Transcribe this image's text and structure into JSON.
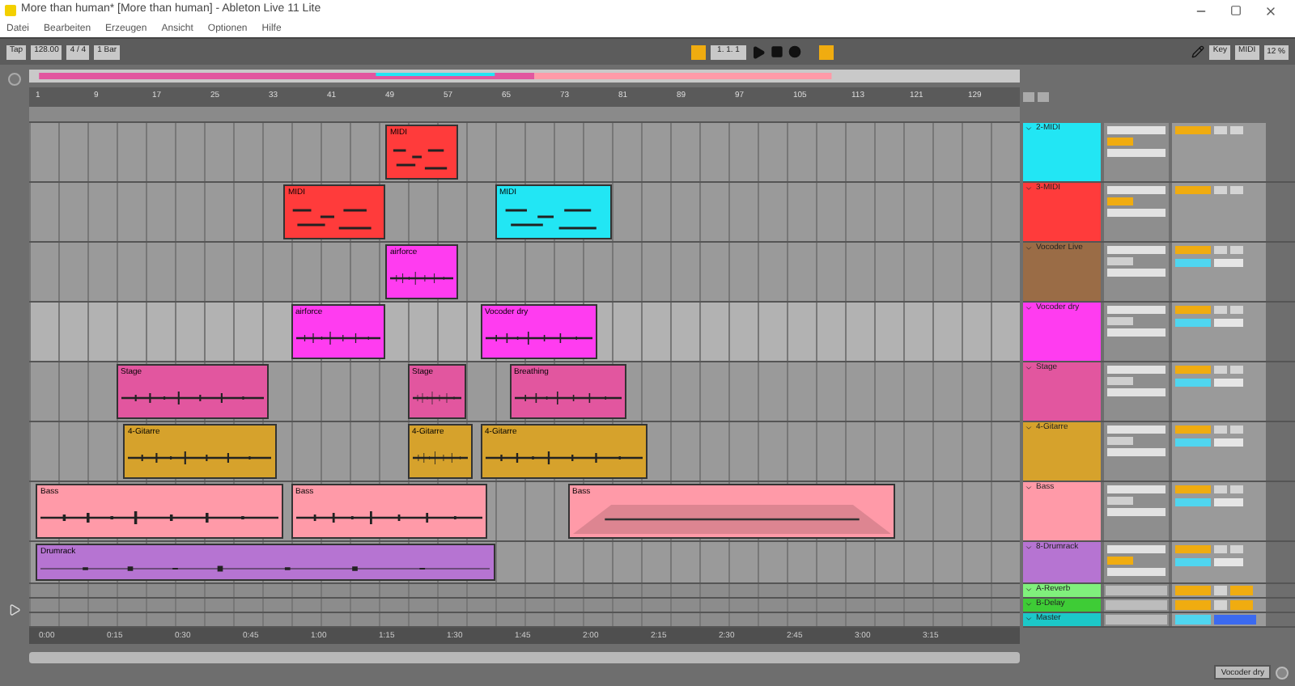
{
  "window": {
    "title": "More than human* [More than human] - Ableton Live 11 Lite"
  },
  "menu": [
    "Datei",
    "Bearbeiten",
    "Erzeugen",
    "Ansicht",
    "Optionen",
    "Hilfe"
  ],
  "toolbar": {
    "tap": "Tap",
    "tempo": "128.00",
    "signature": "4 / 4",
    "quantize": "1 Bar",
    "position": "1. 1. 1",
    "key": "Key",
    "midi": "MIDI",
    "cpu": "12 %"
  },
  "bar_ruler": [
    "1",
    "9",
    "17",
    "25",
    "33",
    "41",
    "49",
    "57",
    "65",
    "73",
    "81",
    "89",
    "97",
    "105",
    "113",
    "121",
    "129"
  ],
  "time_ruler": [
    "0:00",
    "0:15",
    "0:30",
    "0:45",
    "1:00",
    "1:15",
    "1:30",
    "1:45",
    "2:00",
    "2:15",
    "2:30",
    "2:45",
    "3:00",
    "3:15"
  ],
  "tracks": [
    {
      "name": "2-MIDI",
      "color": "#22e6f4",
      "kind": "midi",
      "selected": false,
      "monitor_on": true,
      "clips": [
        {
          "name": "MIDI",
          "color": "#ff3b3b",
          "kind": "midi"
        }
      ]
    },
    {
      "name": "3-MIDI",
      "color": "#ff3b3b",
      "kind": "midi",
      "selected": false,
      "monitor_on": true,
      "clips": [
        {
          "name": "MIDI",
          "color": "#ff3b3b",
          "kind": "midi"
        },
        {
          "name": "MIDI",
          "color": "#22e6f4",
          "kind": "midi"
        }
      ]
    },
    {
      "name": "Vocoder Live",
      "color": "#9a6c46",
      "kind": "audio",
      "selected": false,
      "monitor_on": false,
      "clips": [
        {
          "name": "airforce",
          "color": "#ff3cf0",
          "kind": "audio"
        }
      ]
    },
    {
      "name": "Vocoder dry",
      "color": "#ff3cf0",
      "kind": "audio",
      "selected": true,
      "monitor_on": false,
      "clips": [
        {
          "name": "airforce",
          "color": "#ff3cf0",
          "kind": "audio"
        },
        {
          "name": "Vocoder dry",
          "color": "#ff3cf0",
          "kind": "audio"
        }
      ]
    },
    {
      "name": "Stage",
      "color": "#e2569f",
      "kind": "audio",
      "selected": false,
      "monitor_on": false,
      "clips": [
        {
          "name": "Stage",
          "color": "#e2569f",
          "kind": "audio"
        },
        {
          "name": "Stage",
          "color": "#e2569f",
          "kind": "audio"
        },
        {
          "name": "Breathing",
          "color": "#e2569f",
          "kind": "audio"
        }
      ]
    },
    {
      "name": "4-Gitarre",
      "color": "#d6a22c",
      "kind": "audio",
      "selected": false,
      "monitor_on": false,
      "clips": [
        {
          "name": "4-Gitarre",
          "color": "#d6a22c",
          "kind": "audio"
        },
        {
          "name": "4-Gitarre",
          "color": "#d6a22c",
          "kind": "audio"
        },
        {
          "name": "4-Gitarre",
          "color": "#d6a22c",
          "kind": "audio"
        }
      ]
    },
    {
      "name": "Bass",
      "color": "#ff9aa8",
      "kind": "audio",
      "selected": false,
      "monitor_on": false,
      "clips": [
        {
          "name": "Bass",
          "color": "#ff9aa8",
          "kind": "audio"
        },
        {
          "name": "Bass",
          "color": "#ff9aa8",
          "kind": "audio"
        },
        {
          "name": "Bass",
          "color": "#ff9aa8",
          "kind": "fade"
        }
      ]
    },
    {
      "name": "8-Drumrack",
      "color": "#b674d2",
      "kind": "instrument",
      "selected": false,
      "monitor_on": true,
      "clips": [
        {
          "name": "Drumrack",
          "color": "#b674d2",
          "kind": "audio"
        }
      ]
    },
    {
      "name": "A-Reverb",
      "color": "#80f07c",
      "kind": "return",
      "selected": false
    },
    {
      "name": "B-Delay",
      "color": "#3ecc36",
      "kind": "return",
      "selected": false
    },
    {
      "name": "Master",
      "color": "#1cc8c8",
      "kind": "master",
      "selected": false
    }
  ],
  "status": {
    "selected_track": "Vocoder dry"
  }
}
